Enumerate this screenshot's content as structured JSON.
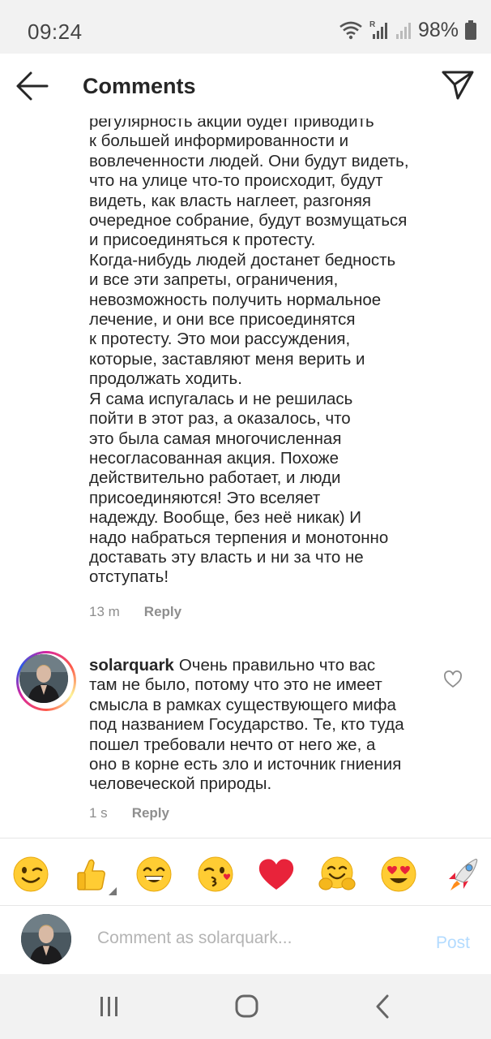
{
  "status_bar": {
    "time": "09:24",
    "battery": "98%"
  },
  "header": {
    "title": "Comments"
  },
  "comments": [
    {
      "text": "регулярность акции будет приводить\nк большей информированности и\nвовлеченности людей. Они будут видеть,\nчто на улице что-то происходит, будут\nвидеть, как власть наглеет, разгоняя\nочередное собрание, будут возмущаться\nи присоединяться к протесту.\nКогда-нибудь людей достанет бедность\nи все эти запреты, ограничения,\nневозможность получить нормальное\nлечение, и они все присоединятся\nк протесту. Это мои рассуждения,\nкоторые, заставляют меня верить и\nпродолжать ходить.\nЯ сама испугалась и не решилась\nпойти в этот раз, а оказалось, что\nэто была самая многочисленная\nнесогласованная акция. Похоже\nдействительно работает, и люди\nприсоединяются! Это вселяет\nнадежду. Вообще, без неё никак) И\nнадо набраться терпения и монотонно\nдоставать эту власть и ни за что не\nотступать!",
      "time": "13 m",
      "reply": "Reply"
    },
    {
      "username": "solarquark",
      "text": "Очень правильно что вас\nтам не было, потому что это не имеет\nсмысла в рамках существующего мифа\nпод названием Государство. Те, кто туда\nпошел требовали нечто от него же, а\nоно в корне есть зло и источник гниения\nчеловеческой природы.",
      "time": "1 s",
      "reply": "Reply"
    }
  ],
  "emoji_bar": [
    {
      "icon": "winking-face-icon"
    },
    {
      "icon": "thumbs-up-icon"
    },
    {
      "icon": "grinning-face-icon"
    },
    {
      "icon": "kissing-heart-face-icon"
    },
    {
      "icon": "red-heart-icon"
    },
    {
      "icon": "hugging-face-icon"
    },
    {
      "icon": "heart-eyes-face-icon"
    },
    {
      "icon": "rocket-icon"
    }
  ],
  "composer": {
    "placeholder": "Comment as solarquark...",
    "post_label": "Post"
  },
  "colors": {
    "accent_disabled": "#b3dbff",
    "secondary_text": "#8e8e8e"
  }
}
